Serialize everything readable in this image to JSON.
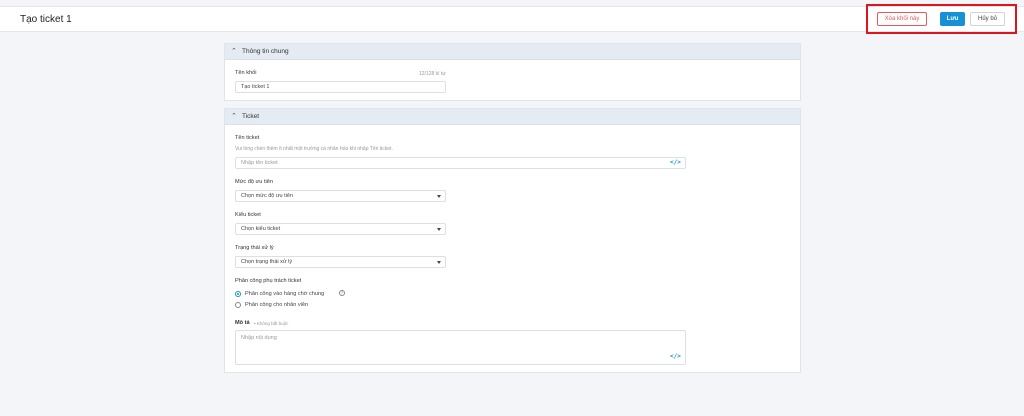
{
  "header": {
    "title": "Tạo ticket 1",
    "delete_label": "Xóa khối này",
    "save_label": "Lưu",
    "cancel_label": "Hủy bỏ"
  },
  "general": {
    "section_title": "Thông tin chung",
    "block_name_label": "Tên khối",
    "char_count": "12/128 kí tự",
    "block_name_value": "Tạo ticket 1"
  },
  "ticket": {
    "section_title": "Ticket",
    "name_label": "Tên ticket",
    "name_hint": "Vui lòng chèn thêm ít nhất một trường cá nhân hóa khi nhập Tên ticket.",
    "name_placeholder": "Nhập tên ticket",
    "priority_label": "Mức độ ưu tiên",
    "priority_value": "Chọn mức độ ưu tiên",
    "type_label": "Kiểu ticket",
    "type_value": "Chọn kiểu ticket",
    "status_label": "Trạng thái xử lý",
    "status_value": "Chọn trạng thái xử lý",
    "assign_label": "Phân công phụ trách ticket",
    "assign_options": [
      "Phân công vào hàng chờ chung",
      "Phân công cho nhân viên"
    ],
    "assign_selected": 0,
    "desc_label": "Mô tả",
    "desc_optional": "Không bắt buộc",
    "desc_placeholder": "Nhập nội dung"
  },
  "colors": {
    "accent": "#1890d8",
    "danger": "#e05a5a",
    "highlight": "#e0141e",
    "section_header": "#e4ebf3"
  }
}
